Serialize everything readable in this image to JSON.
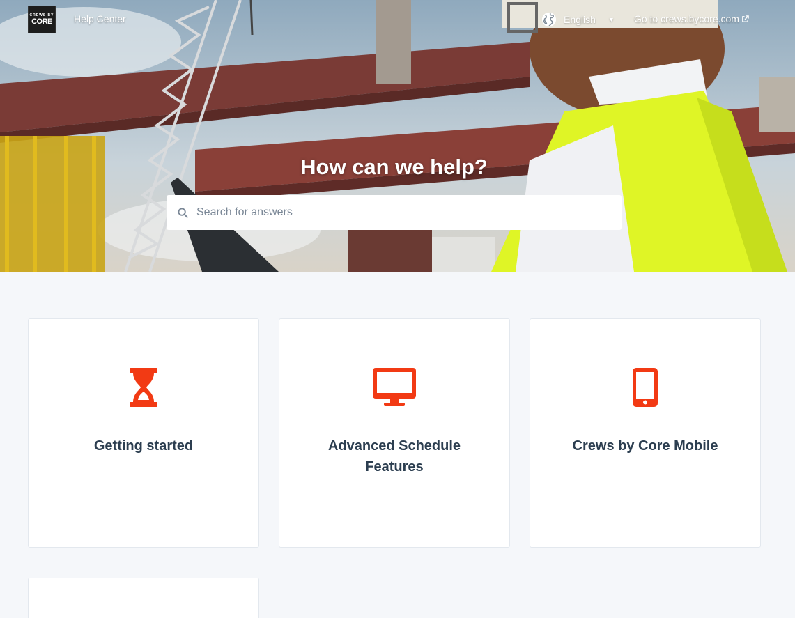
{
  "header": {
    "logo_small_text": "CREWS BY",
    "logo_main_text": "CORE",
    "help_center_label": "Help Center",
    "language_label": "English",
    "external_link_label": "Go to crews.bycore.com"
  },
  "hero": {
    "title": "How can we help?",
    "search_placeholder": "Search for answers"
  },
  "categories": [
    {
      "title": "Getting started",
      "icon": "hourglass-icon"
    },
    {
      "title": "Advanced Schedule Features",
      "icon": "desktop-monitor-icon"
    },
    {
      "title": "Crews by Core Mobile",
      "icon": "mobile-phone-icon"
    }
  ],
  "colors": {
    "accent": "#f23a14",
    "card_title": "#2c3e50",
    "page_background": "#f5f7fa"
  }
}
